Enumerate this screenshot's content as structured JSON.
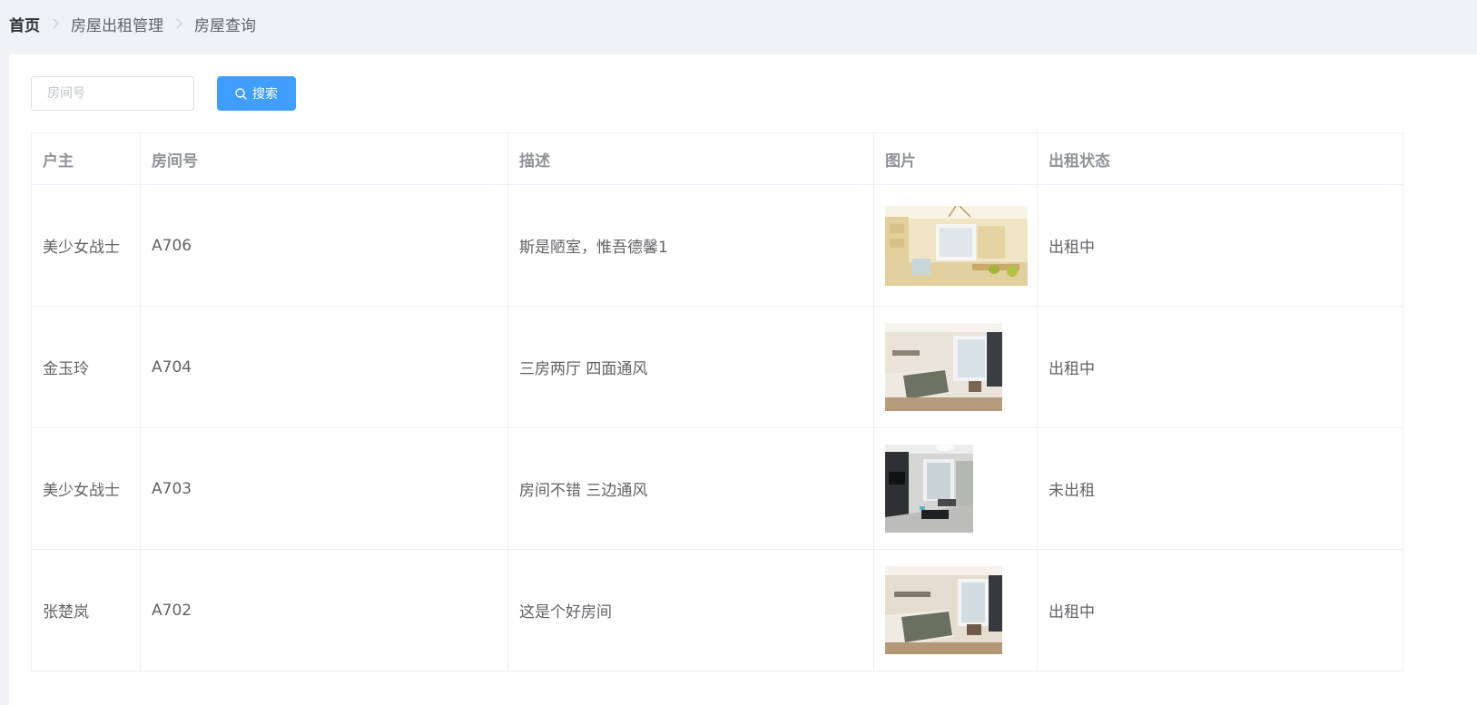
{
  "breadcrumb": {
    "home": "首页",
    "level1": "房屋出租管理",
    "level2": "房屋查询"
  },
  "search": {
    "placeholder": "房间号",
    "value": "",
    "button_label": "搜索"
  },
  "table": {
    "columns": [
      "户主",
      "房间号",
      "描述",
      "图片",
      "出租状态"
    ],
    "rows": [
      {
        "owner": "美少女战士",
        "room": "A706",
        "description": "斯是陋室，惟吾德馨1",
        "image": "living-room-photo",
        "status": "出租中"
      },
      {
        "owner": "金玉玲",
        "room": "A704",
        "description": "三房两厅 四面通风",
        "image": "bedroom-photo",
        "status": "出租中"
      },
      {
        "owner": "美少女战士",
        "room": "A703",
        "description": "房间不错 三边通风",
        "image": "living-room-tv-photo",
        "status": "未出租"
      },
      {
        "owner": "张楚岚",
        "room": "A702",
        "description": "这是个好房间",
        "image": "bedroom-photo",
        "status": "出租中"
      }
    ]
  },
  "colors": {
    "primary": "#409eff",
    "page_background": "#f0f2f5",
    "header_text": "#909399",
    "body_text": "#606266",
    "border": "#ebeef5"
  }
}
